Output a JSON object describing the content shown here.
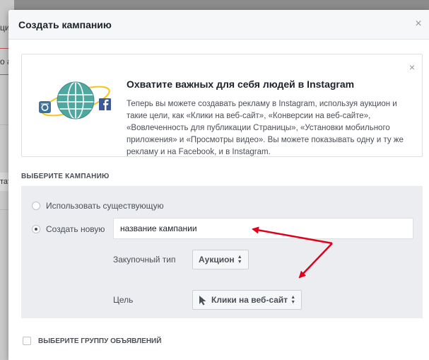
{
  "background": {
    "fragments": [
      "ци",
      "о а",
      "тату"
    ]
  },
  "dialog": {
    "title": "Создать кампанию",
    "close_glyph": "×"
  },
  "promo": {
    "close_glyph": "×",
    "title": "Охватите важных для себя людей в Instagram",
    "text": "Теперь вы можете создавать рекламу в Instagram, используя аукцион и такие цели, как «Клики на веб-сайт», «Конверсии на веб-сайте», «Вовлеченность для публикации Страницы», «Установки мобильного приложения» и «Просмотры видео». Вы можете показывать одну и ту же рекламу и на Facebook, и в Instagram.",
    "icons": [
      "instagram-icon",
      "globe-icon",
      "facebook-icon"
    ],
    "colors": {
      "instagram": "#3f729b",
      "globe": "#4fa8a0",
      "orbit": "#f5c518",
      "facebook": "#3b5998"
    }
  },
  "campaign": {
    "section_label": "ВЫБЕРИТЕ КАМПАНИЮ",
    "use_existing_label": "Использовать существующую",
    "create_new_label": "Создать новую",
    "selected_option": "create_new",
    "name_input_value": "название кампании",
    "buying_type_label": "Закупочный тип",
    "buying_type_value": "Аукцион",
    "objective_label": "Цель",
    "objective_value": "Клики на веб-сайт",
    "objective_icon": "cursor-icon"
  },
  "ad_set": {
    "label": "ВЫБЕРИТЕ ГРУППУ ОБЪЯВЛЕНИЙ",
    "checked": false
  },
  "annotation": {
    "arrow_color": "#e0001b"
  }
}
